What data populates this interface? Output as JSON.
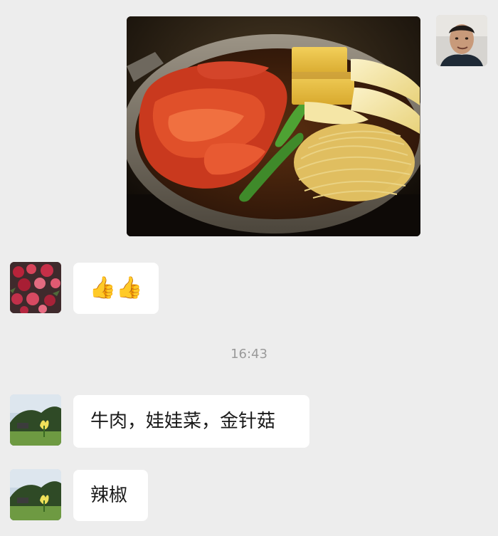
{
  "messages": [
    {
      "sender": "me",
      "type": "image",
      "image_alt": "sukiyaki hot pot with beef, tofu, napa cabbage, enoki mushrooms and green pepper"
    },
    {
      "sender": "friend_flowers",
      "type": "emoji",
      "emoji": "👍👍"
    },
    {
      "type": "timestamp",
      "text": "16:43"
    },
    {
      "sender": "friend_field",
      "type": "text",
      "text": "牛肉，娃娃菜，金针菇"
    },
    {
      "sender": "friend_field",
      "type": "text",
      "text": "辣椒"
    }
  ],
  "colors": {
    "background": "#ededed",
    "bubble": "#ffffff",
    "timestamp_text": "#9a9a9a"
  }
}
